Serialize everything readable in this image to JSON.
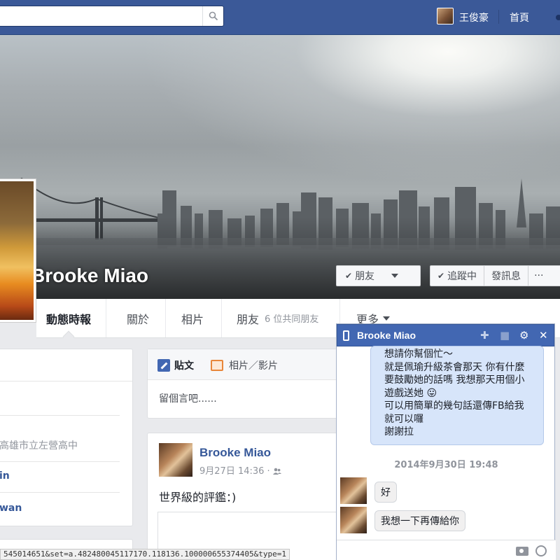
{
  "topbar": {
    "user_name": "王俊豪",
    "home_label": "首頁"
  },
  "profile": {
    "name": "Brooke Miao",
    "friend_button": "朋友",
    "follow_button": "追蹤中",
    "message_button": "發訊息",
    "more_button": "···"
  },
  "nav": {
    "timeline": "動態時報",
    "about": "關於",
    "photos": "相片",
    "friends": "朋友",
    "mutual_friends": "6 位共同朋友",
    "more": "更多"
  },
  "left": {
    "school": "高雄市立左營高中",
    "link1": "in",
    "link2": "wan"
  },
  "composer": {
    "tab_post": "貼文",
    "tab_photo": "相片／影片",
    "placeholder": "留個言吧......"
  },
  "post": {
    "author": "Brooke Miao",
    "timestamp": "9月27日 14:36 · ",
    "text": "世界級的評鑑：)"
  },
  "chat": {
    "title": "Brooke Miao",
    "my_message_lines": [
      "想請你幫個忙～",
      "就是佩瑜升級茶會那天 你有什麼",
      "要鼓勵她的話嗎 我想那天用個小",
      "遊戲送她 😛",
      "可以用簡單的幾句話還傳FB給我",
      "就可以囉",
      "謝謝拉"
    ],
    "date_divider": "2014年9月30日 19:48",
    "reply1": "好",
    "reply2": "我想一下再傳給你"
  },
  "statusbar": {
    "url": "545014651&set=a.482480045117170.118136.100000655374405&type=1"
  },
  "colors": {
    "topbar": "#3b5998",
    "chat_header": "#4267b2",
    "link": "#365899",
    "my_bubble": "#d7e5fa"
  }
}
